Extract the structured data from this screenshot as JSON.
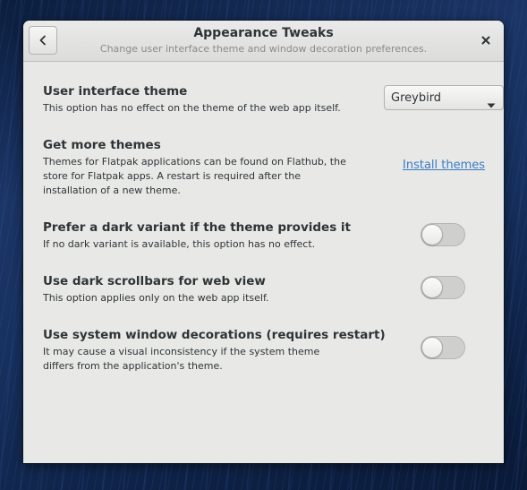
{
  "window": {
    "title": "Appearance Tweaks",
    "subtitle": "Change user interface theme and window decoration preferences.",
    "back_icon": "chevron-left-icon",
    "close_icon": "close-icon"
  },
  "settings": {
    "theme": {
      "label": "User interface theme",
      "description": "This option has no effect on the theme of the web app itself.",
      "selected": "Greybird"
    },
    "more_themes": {
      "label": "Get more themes",
      "description": "Themes for Flatpak applications can be found on Flathub, the store for Flatpak apps. A restart is required after the installation of a new theme.",
      "link_label": "Install themes"
    },
    "dark_variant": {
      "label": "Prefer a dark variant if the theme provides it",
      "description": "If no dark variant is available, this option has no effect.",
      "enabled": false
    },
    "dark_scrollbars": {
      "label": "Use dark scrollbars for web view",
      "description": "This option applies only on the web app itself.",
      "enabled": false
    },
    "system_decorations": {
      "label": "Use system window decorations (requires restart)",
      "description": "It may cause a visual inconsistency if the system theme differs from the application's theme.",
      "enabled": false
    }
  },
  "colors": {
    "link": "#3a7bc8",
    "text": "#2e3436",
    "window_bg": "#e8e8e7"
  }
}
